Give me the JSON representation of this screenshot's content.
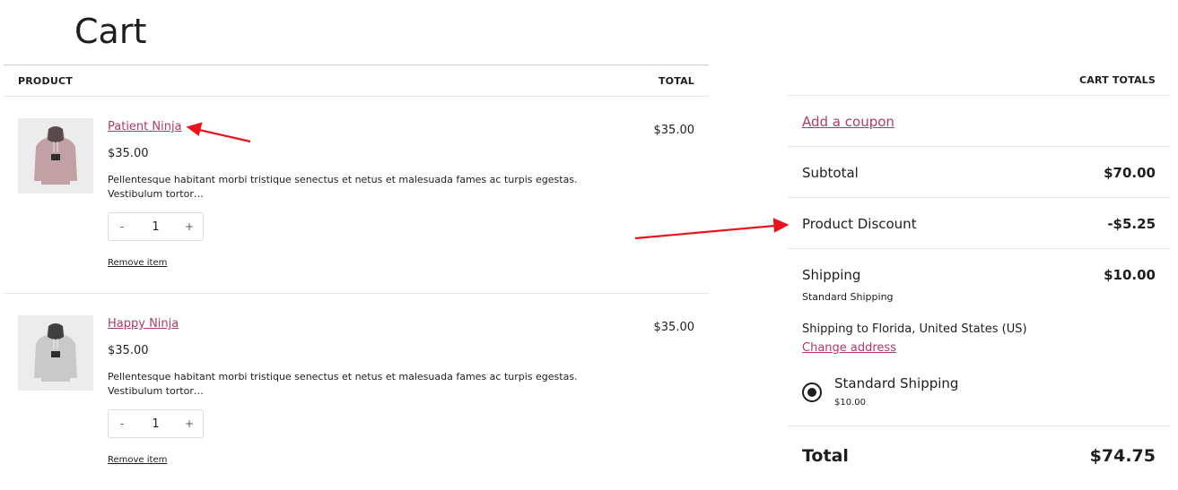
{
  "page": {
    "title": "Cart"
  },
  "cart": {
    "columns": {
      "product": "PRODUCT",
      "total": "TOTAL"
    },
    "items": [
      {
        "name": "Patient Ninja",
        "price": "$35.00",
        "description": "Pellentesque habitant morbi tristique senectus et netus et malesuada fames ac turpis egestas. Vestibulum tortor…",
        "quantity": "1",
        "minus": "-",
        "plus": "+",
        "remove_label": "Remove item",
        "total": "$35.00",
        "image": "pink-hoodie"
      },
      {
        "name": "Happy Ninja",
        "price": "$35.00",
        "description": "Pellentesque habitant morbi tristique senectus et netus et malesuada fames ac turpis egestas. Vestibulum tortor…",
        "quantity": "1",
        "minus": "-",
        "plus": "+",
        "remove_label": "Remove item",
        "total": "$35.00",
        "image": "grey-hoodie"
      }
    ]
  },
  "totals": {
    "heading": "CART TOTALS",
    "coupon_link": "Add a coupon",
    "subtotal": {
      "label": "Subtotal",
      "amount": "$70.00"
    },
    "discount": {
      "label": "Product Discount",
      "amount": "-$5.25"
    },
    "shipping": {
      "label": "Shipping",
      "amount": "$10.00",
      "method": "Standard Shipping",
      "destination": "Shipping to Florida, United States (US)",
      "change_link": "Change address",
      "option_label": "Standard Shipping",
      "option_price": "$10.00",
      "selected": true
    },
    "total": {
      "label": "Total",
      "amount": "$74.75"
    }
  },
  "colors": {
    "link": "#b2396a",
    "annotation_arrow": "#e8141b",
    "text": "#1e1e1e"
  }
}
